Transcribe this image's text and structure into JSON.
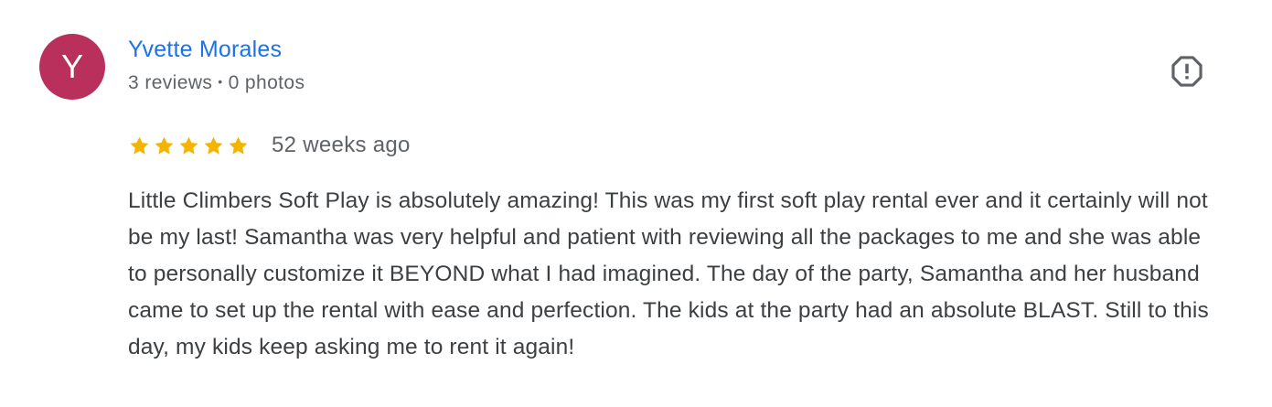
{
  "colors": {
    "avatar_bg": "#B8305B",
    "name": "#1A73E8",
    "meta": "#5F6368",
    "star": "#F4B400",
    "text": "#3C4043",
    "icon": "#5F6368"
  },
  "reviewer": {
    "initial": "Y",
    "name": "Yvette Morales",
    "reviews": "3 reviews",
    "separator": "•",
    "photos": "0 photos"
  },
  "report": {
    "icon": "report-octagon-icon"
  },
  "rating": {
    "stars": 5,
    "max_stars": 5,
    "time": "52 weeks ago"
  },
  "review": {
    "text": "Little Climbers Soft Play is absolutely amazing! This was my first soft play rental ever and it certainly will not be my last! Samantha was very helpful and patient with reviewing all the packages to me and she was able to personally customize it BEYOND what I had imagined. The day of the party, Samantha and her husband came to set up the rental with ease and perfection. The kids at the party had an absolute BLAST. Still to this day, my kids keep asking me to rent it again!"
  }
}
